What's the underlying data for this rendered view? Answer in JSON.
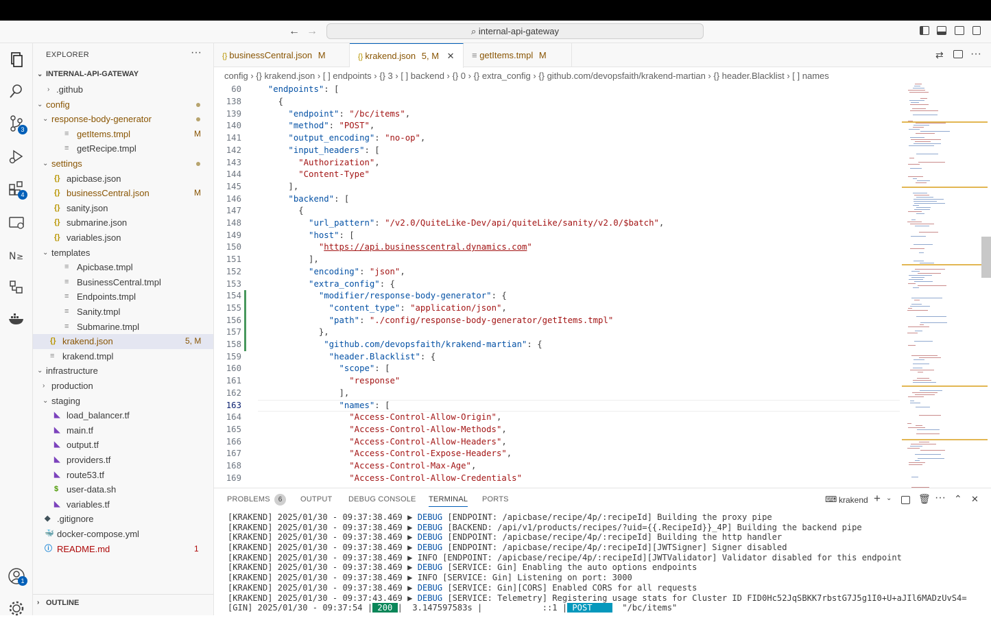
{
  "window": {
    "command_center": "internal-api-gateway"
  },
  "activity": {
    "scm_badge": "3",
    "extensions_badge": "4",
    "accounts_badge": "1"
  },
  "explorer": {
    "title": "EXPLORER",
    "root": "INTERNAL-API-GATEWAY",
    "outline": "OUTLINE",
    "items": [
      {
        "label": "github_dir",
        "text": ".github",
        "status": ""
      },
      {
        "text": "config",
        "status": ""
      },
      {
        "text": "response-body-generator",
        "status": ""
      },
      {
        "text": "getItems.tmpl",
        "status": "M"
      },
      {
        "text": "getRecipe.tmpl",
        "status": ""
      },
      {
        "text": "settings",
        "status": ""
      },
      {
        "text": "apicbase.json",
        "status": ""
      },
      {
        "text": "businessCentral.json",
        "status": "M"
      },
      {
        "text": "sanity.json",
        "status": ""
      },
      {
        "text": "submarine.json",
        "status": ""
      },
      {
        "text": "variables.json",
        "status": ""
      },
      {
        "text": "templates",
        "status": ""
      },
      {
        "text": "Apicbase.tmpl",
        "status": ""
      },
      {
        "text": "BusinessCentral.tmpl",
        "status": ""
      },
      {
        "text": "Endpoints.tmpl",
        "status": ""
      },
      {
        "text": "Sanity.tmpl",
        "status": ""
      },
      {
        "text": "Submarine.tmpl",
        "status": ""
      },
      {
        "text": "krakend.json",
        "status": "5, M"
      },
      {
        "text": "krakend.tmpl",
        "status": ""
      },
      {
        "text": "infrastructure",
        "status": ""
      },
      {
        "text": "production",
        "status": ""
      },
      {
        "text": "staging",
        "status": ""
      },
      {
        "text": "load_balancer.tf",
        "status": ""
      },
      {
        "text": "main.tf",
        "status": ""
      },
      {
        "text": "output.tf",
        "status": ""
      },
      {
        "text": "providers.tf",
        "status": ""
      },
      {
        "text": "route53.tf",
        "status": ""
      },
      {
        "text": "user-data.sh",
        "status": ""
      },
      {
        "text": "variables.tf",
        "status": ""
      },
      {
        "text": ".gitignore",
        "status": ""
      },
      {
        "text": "docker-compose.yml",
        "status": ""
      },
      {
        "text": "README.md",
        "status": "1"
      }
    ]
  },
  "tabs": [
    {
      "label": "businessCentral.json",
      "status": "M"
    },
    {
      "label": "krakend.json",
      "status": "5, M"
    },
    {
      "label": "getItems.tmpl",
      "status": "M"
    }
  ],
  "breadcrumbs": [
    "config",
    "{} krakend.json",
    "[ ] endpoints",
    "{} 3",
    "[ ] backend",
    "{} 0",
    "{} extra_config",
    "{} github.com/devopsfaith/krakend-martian",
    "{} header.Blacklist",
    "[ ] names"
  ],
  "code": {
    "sticky": {
      "ln": "60",
      "text": "  \"endpoints\": ["
    },
    "lines": [
      {
        "ln": "138",
        "text": "    {"
      },
      {
        "ln": "139",
        "text": "      \"endpoint\": \"/bc/items\","
      },
      {
        "ln": "140",
        "text": "      \"method\": \"POST\","
      },
      {
        "ln": "141",
        "text": "      \"output_encoding\": \"no-op\","
      },
      {
        "ln": "142",
        "text": "      \"input_headers\": ["
      },
      {
        "ln": "143",
        "text": "        \"Authorization\","
      },
      {
        "ln": "144",
        "text": "        \"Content-Type\""
      },
      {
        "ln": "145",
        "text": "      ],"
      },
      {
        "ln": "146",
        "text": "      \"backend\": ["
      },
      {
        "ln": "147",
        "text": "        {"
      },
      {
        "ln": "148",
        "text": "          \"url_pattern\": \"/v2.0/QuiteLike-Dev/api/quiteLike/sanity/v2.0/$batch\","
      },
      {
        "ln": "149",
        "text": "          \"host\": ["
      },
      {
        "ln": "150",
        "text": "            \"https://api.businesscentral.dynamics.com\""
      },
      {
        "ln": "151",
        "text": "          ],"
      },
      {
        "ln": "152",
        "text": "          \"encoding\": \"json\","
      },
      {
        "ln": "153",
        "text": "          \"extra_config\": {"
      },
      {
        "ln": "154",
        "text": "            \"modifier/response-body-generator\": {"
      },
      {
        "ln": "155",
        "text": "              \"content_type\": \"application/json\","
      },
      {
        "ln": "156",
        "text": "              \"path\": \"./config/response-body-generator/getItems.tmpl\""
      },
      {
        "ln": "157",
        "text": "            },"
      },
      {
        "ln": "158",
        "text": "             \"github.com/devopsfaith/krakend-martian\": {"
      },
      {
        "ln": "159",
        "text": "              \"header.Blacklist\": {"
      },
      {
        "ln": "160",
        "text": "                \"scope\": ["
      },
      {
        "ln": "161",
        "text": "                  \"response\""
      },
      {
        "ln": "162",
        "text": "                ],"
      },
      {
        "ln": "163",
        "text": "                \"names\": ["
      },
      {
        "ln": "164",
        "text": "                  \"Access-Control-Allow-Origin\","
      },
      {
        "ln": "165",
        "text": "                  \"Access-Control-Allow-Methods\","
      },
      {
        "ln": "166",
        "text": "                  \"Access-Control-Allow-Headers\","
      },
      {
        "ln": "167",
        "text": "                  \"Access-Control-Expose-Headers\","
      },
      {
        "ln": "168",
        "text": "                  \"Access-Control-Max-Age\","
      },
      {
        "ln": "169",
        "text": "                  \"Access-Control-Allow-Credentials\""
      }
    ]
  },
  "panel": {
    "tabs": [
      "PROBLEMS",
      "OUTPUT",
      "DEBUG CONSOLE",
      "TERMINAL",
      "PORTS"
    ],
    "problems_count": "6",
    "terminal_name": "krakend",
    "lines": [
      {
        "pre": "[KRAKEND] 2025/01/30 - 09:37:38.469 ▶ ",
        "level": "DEBUG",
        "msg": " [ENDPOINT: /apicbase/recipe/4p/:recipeId] Building the proxy pipe"
      },
      {
        "pre": "[KRAKEND] 2025/01/30 - 09:37:38.469 ▶ ",
        "level": "DEBUG",
        "msg": " [BACKEND: /api/v1/products/recipes/?uid={{.RecipeId}}_4P] Building the backend pipe"
      },
      {
        "pre": "[KRAKEND] 2025/01/30 - 09:37:38.469 ▶ ",
        "level": "DEBUG",
        "msg": " [ENDPOINT: /apicbase/recipe/4p/:recipeId] Building the http handler"
      },
      {
        "pre": "[KRAKEND] 2025/01/30 - 09:37:38.469 ▶ ",
        "level": "DEBUG",
        "msg": " [ENDPOINT: /apicbase/recipe/4p/:recipeId][JWTSigner] Signer disabled"
      },
      {
        "pre": "[KRAKEND] 2025/01/30 - 09:37:38.469 ▶ ",
        "level": "INFO",
        "msg": " [ENDPOINT: /apicbase/recipe/4p/:recipeId][JWTValidator] Validator disabled for this endpoint"
      },
      {
        "pre": "[KRAKEND] 2025/01/30 - 09:37:38.469 ▶ ",
        "level": "DEBUG",
        "msg": " [SERVICE: Gin] Enabling the auto options endpoints"
      },
      {
        "pre": "[KRAKEND] 2025/01/30 - 09:37:38.469 ▶ ",
        "level": "INFO",
        "msg": " [SERVICE: Gin] Listening on port: 3000"
      },
      {
        "pre": "[KRAKEND] 2025/01/30 - 09:37:38.469 ▶ ",
        "level": "DEBUG",
        "msg": " [SERVICE: Gin][CORS] Enabled CORS for all requests"
      },
      {
        "pre": "[KRAKEND] 2025/01/30 - 09:37:43.469 ▶ ",
        "level": "DEBUG",
        "msg": " [SERVICE: Telemetry] Registering usage stats for Cluster ID FID0Hc52JqSBKK7rbstG7J5g1I0+U+aJIl6MADzUvS4="
      }
    ],
    "gin": {
      "pre": "[GIN] 2025/01/30 - 09:37:54 |",
      "status": " 200 ",
      "mid": "|  3.147597583s |            ::1 |",
      "method": " POST    ",
      "path": "  \"/bc/items\""
    }
  }
}
